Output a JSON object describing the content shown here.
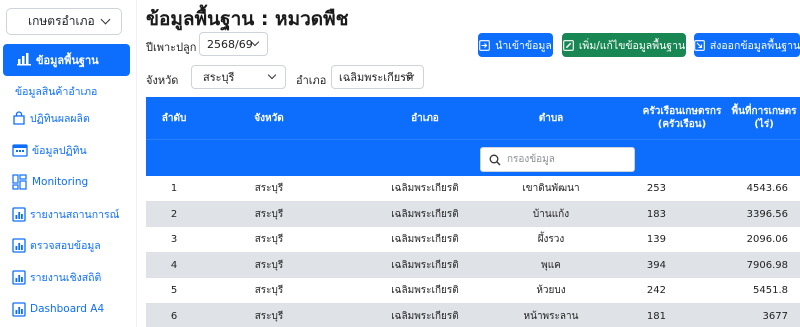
{
  "sidebar": {
    "role": "เกษตรอำเภอ",
    "active_item": "ข้อมูลพื้นฐาน",
    "sub_item": "ข้อมูลสินค้าอำเภอ",
    "items": [
      {
        "label": "ปฏิทินผลผลิต",
        "icon": "bag-icon"
      },
      {
        "label": "ข้อมูลปฏิทิน",
        "icon": "calendar-icon"
      },
      {
        "label": "Monitoring",
        "icon": "dashboard-grid-icon"
      },
      {
        "label": "รายงานสถานการณ์",
        "icon": "report-icon"
      },
      {
        "label": "ตรวจสอบข้อมูล",
        "icon": "report-icon"
      },
      {
        "label": "รายงานเชิงสถิติ",
        "icon": "report-icon"
      },
      {
        "label": "Dashboard A4",
        "icon": "report-icon"
      }
    ]
  },
  "header": {
    "title": "ข้อมูลพื้นฐาน : หมวดพืช",
    "season_label": "ปีเพาะปลูก",
    "season_value": "2568/69"
  },
  "buttons": {
    "import": "นำเข้าข้อมูล",
    "edit": "เพิ่ม/แก้ไขข้อมูลพื้นฐาน",
    "export": "ส่งออกข้อมูลพื้นฐาน"
  },
  "filters": {
    "province_label": "จังหวัด",
    "province_value": "สระบุรี",
    "district_label": "อำเภอ",
    "district_value": "เฉลิมพระเกียรติ"
  },
  "table": {
    "headers": {
      "index": "ลำดับ",
      "province": "จังหวัด",
      "district": "อำเภอ",
      "subdistrict": "ตำบล",
      "households": "ครัวเรือนเกษตรกร (ครัวเรือน)",
      "area": "พื้นที่การเกษตร (ไร่)"
    },
    "search_placeholder": "กรองข้อมูล",
    "rows": [
      {
        "index": "1",
        "province": "สระบุรี",
        "district": "เฉลิมพระเกียรติ",
        "subdistrict": "เขาดินพัฒนา",
        "households": "253",
        "area": "4543.66"
      },
      {
        "index": "2",
        "province": "สระบุรี",
        "district": "เฉลิมพระเกียรติ",
        "subdistrict": "บ้านแก้ง",
        "households": "183",
        "area": "3396.56"
      },
      {
        "index": "3",
        "province": "สระบุรี",
        "district": "เฉลิมพระเกียรติ",
        "subdistrict": "ผึ้งรวง",
        "households": "139",
        "area": "2096.06"
      },
      {
        "index": "4",
        "province": "สระบุรี",
        "district": "เฉลิมพระเกียรติ",
        "subdistrict": "พุแค",
        "households": "394",
        "area": "7906.98"
      },
      {
        "index": "5",
        "province": "สระบุรี",
        "district": "เฉลิมพระเกียรติ",
        "subdistrict": "ห้วยบง",
        "households": "242",
        "area": "5451.8"
      },
      {
        "index": "6",
        "province": "สระบุรี",
        "district": "เฉลิมพระเกียรติ",
        "subdistrict": "หน้าพระลาน",
        "households": "181",
        "area": "3677"
      }
    ]
  },
  "colors": {
    "primary": "#0d6efd",
    "success": "#198754",
    "row_alt": "#dfe3e8"
  }
}
